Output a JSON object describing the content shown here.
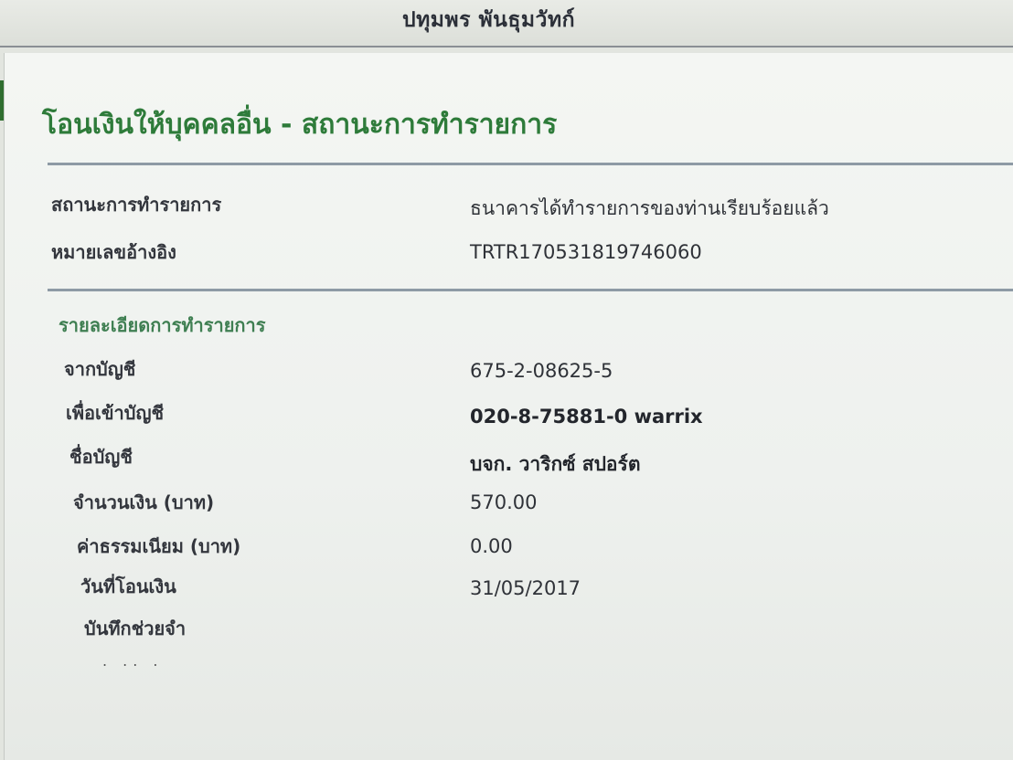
{
  "header": {
    "user_name": "ปทุมพร พันธุมวัทก์"
  },
  "page": {
    "title": "โอนเงินให้บุคคลอื่น - สถานะการทำรายการ"
  },
  "summary": {
    "status_label": "สถานะการทำรายการ",
    "status_value": "ธนาคารได้ทำรายการของท่านเรียบร้อยแล้ว",
    "reference_label": "หมายเลขอ้างอิง",
    "reference_value": "TRTR170531819746060"
  },
  "details": {
    "section_title": "รายละเอียดการทำรายการ",
    "from_account_label": "จากบัญชี",
    "from_account_value": "675-2-08625-5",
    "to_account_label": "เพื่อเข้าบัญชี",
    "to_account_value": "020-8-75881-0 warrix",
    "account_name_label": "ชื่อบัญชี",
    "account_name_value": "บจก. วาริกซ์ สปอร์ต",
    "amount_label": "จำนวนเงิน (บาท)",
    "amount_value": "570.00",
    "fee_label": "ค่าธรรมเนียม (บาท)",
    "fee_value": "0.00",
    "transfer_date_label": "วันที่โอนเงิน",
    "transfer_date_value": "31/05/2017",
    "memo_label": "บันทึกช่วยจำ",
    "memo_value": ""
  },
  "colors": {
    "title_green": "#2e7b3a",
    "section_green": "#3f7f52",
    "rule_gray": "#8e9aa5"
  }
}
